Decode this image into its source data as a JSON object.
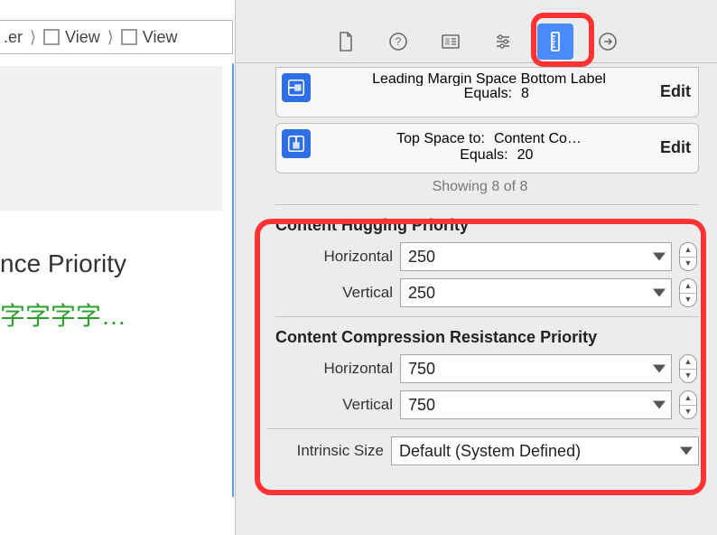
{
  "breadcrumbs": {
    "item0": ".er",
    "item1": "View",
    "item2": "View"
  },
  "canvas": {
    "label_main": "nce Priority",
    "label_green": "字字字字…"
  },
  "inspector_tabs": {
    "file": "file-icon",
    "help": "help-icon",
    "identity": "identity-icon",
    "attributes": "attributes-icon",
    "size": "size-icon",
    "connections": "connections-icon"
  },
  "constraints": {
    "row0": {
      "title": "Leading Margin Space Bottom Label",
      "equals_label": "Equals:",
      "equals_value": "8",
      "edit": "Edit"
    },
    "row1": {
      "title_label": "Top Space to:",
      "title_value": "Content Co…",
      "equals_label": "Equals:",
      "equals_value": "20",
      "edit": "Edit"
    },
    "showing": "Showing 8 of 8"
  },
  "hugging": {
    "title": "Content Hugging Priority",
    "horizontal_label": "Horizontal",
    "horizontal_value": "250",
    "vertical_label": "Vertical",
    "vertical_value": "250"
  },
  "compression": {
    "title": "Content Compression Resistance Priority",
    "horizontal_label": "Horizontal",
    "horizontal_value": "750",
    "vertical_label": "Vertical",
    "vertical_value": "750"
  },
  "intrinsic": {
    "label": "Intrinsic Size",
    "value": "Default (System Defined)"
  }
}
